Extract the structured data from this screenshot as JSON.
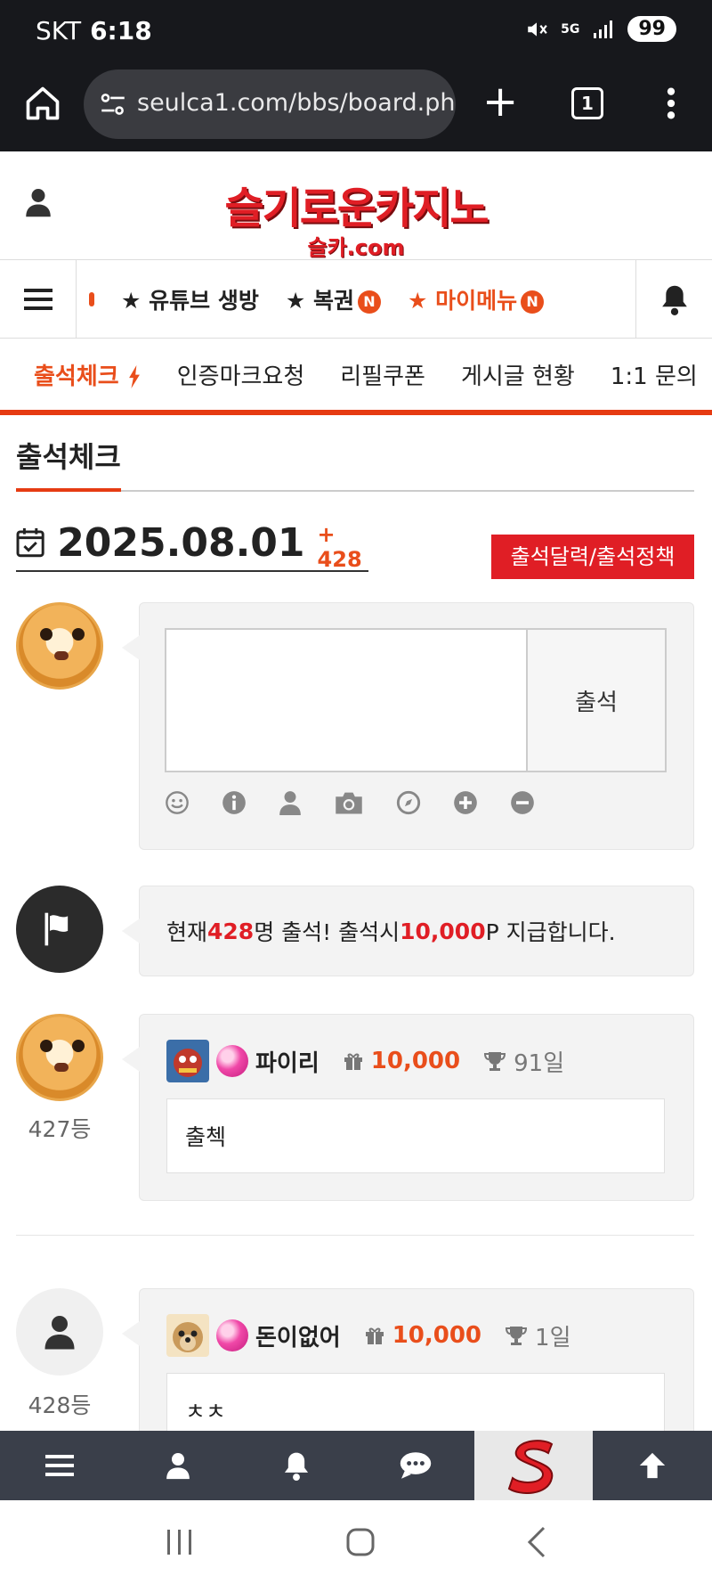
{
  "status_bar": {
    "carrier": "SKT",
    "time": "6:18",
    "network": "5G",
    "battery": "99"
  },
  "browser": {
    "url": "seulca1.com/bbs/board.php",
    "tab_count": "1"
  },
  "site": {
    "logo_main": "슬기로운카지노",
    "logo_sub": "슬카.com"
  },
  "main_nav": {
    "items": [
      {
        "label": "★ 유튜브 생방"
      },
      {
        "label": "★ 복권",
        "badge": "N"
      },
      {
        "label": "★ 마이메뉴",
        "badge": "N"
      }
    ]
  },
  "sub_nav": {
    "items": [
      "출석체크",
      "인증마크요청",
      "리필쿠폰",
      "게시글 현황",
      "1:1 문의"
    ]
  },
  "page": {
    "title": "출석체크",
    "date": "2025.08.01",
    "count": "+ 428",
    "policy_button": "출석달력/출석정책"
  },
  "form": {
    "submit_label": "출석",
    "textarea_value": ""
  },
  "notice": {
    "prefix": "현재 ",
    "count": "428",
    "mid": "명 출석! 출석시 ",
    "points": "10,000",
    "suffix": "P 지급합니다."
  },
  "entries": [
    {
      "rank": "427등",
      "nickname": "파이리",
      "points": "10,000",
      "days": "91일",
      "comment": "출첵"
    },
    {
      "rank": "428등",
      "nickname": "돈이없어",
      "points": "10,000",
      "days": "1일",
      "comment": "ㅊㅊ"
    }
  ],
  "colors": {
    "accent": "#e94e1b",
    "brand_red": "#e01e25",
    "dark": "#17181c",
    "bottom_nav": "#3a3f4a"
  }
}
